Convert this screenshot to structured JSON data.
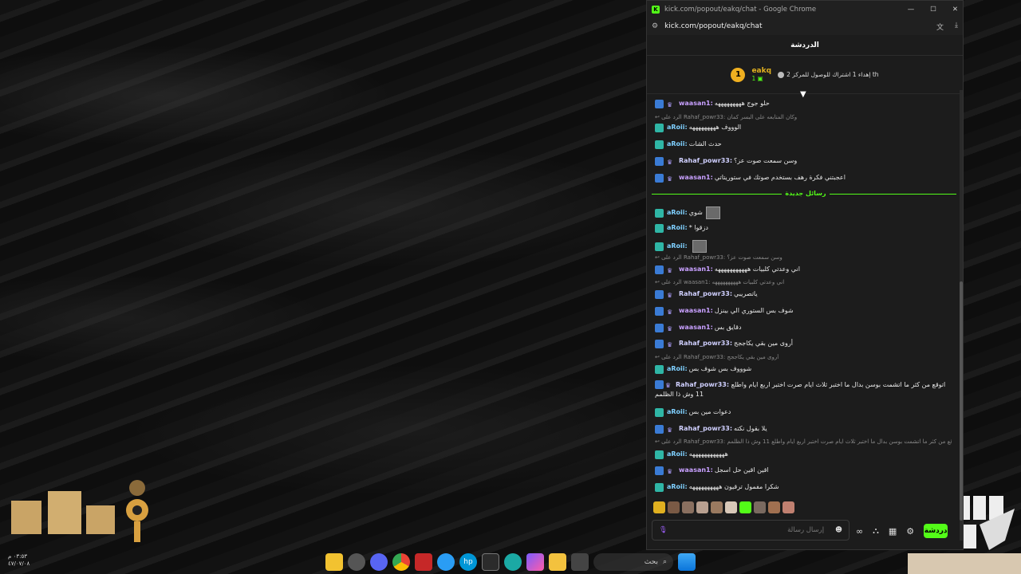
{
  "window": {
    "title": "kick.com/popout/eakq/chat - Google Chrome",
    "url": "kick.com/popout/eakq/chat",
    "controls": [
      "—",
      "☐",
      "✕"
    ]
  },
  "chat": {
    "header": "الدردشة",
    "pinned": {
      "rank": "1",
      "username": "eakq",
      "sub_count": "1",
      "goal_text": "إهداء 1 اشتراك للوصول للمركز 2 th"
    },
    "new_messages_label": "رسائل جديدة",
    "messages": [
      {
        "user": "waasan1:",
        "text": "حلو جوج هههههههههه",
        "cls": "c-waasan",
        "badge": "blue"
      },
      {
        "reply": "الرد على Rahaf_powr33: وكان المتابعه على البسر كمان"
      },
      {
        "user": "aRoii:",
        "text": "الوووف هههههههههه",
        "cls": "c-aroii",
        "badge": "teal"
      },
      {
        "user": "aRoii:",
        "text": "حدث الشات",
        "cls": "c-aroii",
        "badge": "teal"
      },
      {
        "user": "Rahaf_powr33:",
        "text": "وسن سمعت صوت عز؟",
        "cls": "c-rahaf",
        "badge": "blue"
      },
      {
        "user": "waasan1:",
        "text": "اعجبتني فكرة رهف بستخدم صوتك في ستوريتاتي",
        "cls": "c-waasan",
        "badge": "blue"
      },
      {
        "user": "aRoii:",
        "text": "شوي",
        "cls": "c-aroii",
        "badge": "teal"
      },
      {
        "user": "aRoii:",
        "text": "* دزقوا",
        "cls": "c-aroii",
        "badge": "teal"
      },
      {
        "user": "aRoii:",
        "text": "",
        "cls": "c-aroii",
        "badge": "teal"
      },
      {
        "reply": "الرد على Rahaf_powr33: وسن سمعت صوت عز؟"
      },
      {
        "user": "waasan1:",
        "text": "اني وعدتي كلبيات هههههههههههه",
        "cls": "c-waasan",
        "badge": "blue"
      },
      {
        "reply": "الرد على waasan1: اني وعدتي كلبيات ههههههههههه"
      },
      {
        "user": "Rahaf_powr33:",
        "text": "ياتصريبي",
        "cls": "c-rahaf",
        "badge": "blue"
      },
      {
        "user": "waasan1:",
        "text": "شوف بس الستوري الي بينزل",
        "cls": "c-waasan",
        "badge": "blue"
      },
      {
        "user": "waasan1:",
        "text": "دقايق بس",
        "cls": "c-waasan",
        "badge": "blue"
      },
      {
        "user": "Rahaf_powr33:",
        "text": "أروى مين بقي يكاججج",
        "cls": "c-rahaf",
        "badge": "blue"
      },
      {
        "reply": "الرد على Rahaf_powr33: أروى مين بقي يكاججج"
      },
      {
        "user": "aRoii:",
        "text": "شوووف بس شوف بس",
        "cls": "c-aroii",
        "badge": "teal"
      },
      {
        "user": "Rahaf_powr33:",
        "text": "اتوقع من كثر ما اتشمت بوسن بدال ما اختبر ثلاث ايام صرت اختبر اربع ايام واطلع 11 وش ذا الظلمم",
        "cls": "c-rahaf",
        "badge": "blue",
        "wrap": true
      },
      {
        "user": "aRoii:",
        "text": "دعوات مين بس",
        "cls": "c-aroii",
        "badge": "teal"
      },
      {
        "user": "Rahaf_powr33:",
        "text": "يلا بقول نكته",
        "cls": "c-rahaf",
        "badge": "blue"
      },
      {
        "reply": "الرد على Rahaf_powr33: اتوقع من كثر ما اتشمت بوسن بدال ما اختبر ثلاث ايام صرت اختبر اربع ايام واطلع 11 وش ذا الظلمم"
      },
      {
        "user": "aRoii:",
        "text": "ههههههههههههه",
        "cls": "c-aroii",
        "badge": "teal"
      },
      {
        "user": "waasan1:",
        "text": "اقين اقين حل اسجل",
        "cls": "c-waasan",
        "badge": "blue"
      },
      {
        "user": "aRoii:",
        "text": "شكرا مفمول ترقيون ههههههههههه",
        "cls": "c-aroii",
        "badge": "teal"
      }
    ],
    "composer_placeholder": "إرسال رسالة",
    "send_label": "دردشة"
  },
  "desktop": {
    "clock_time": "٠٣:٥٣ م",
    "clock_date": "٤٧/٠٧/٠٨",
    "search_label": "بحث"
  },
  "colors": {
    "kick_green": "#53fc18",
    "pinned_gold": "#f0b020"
  }
}
